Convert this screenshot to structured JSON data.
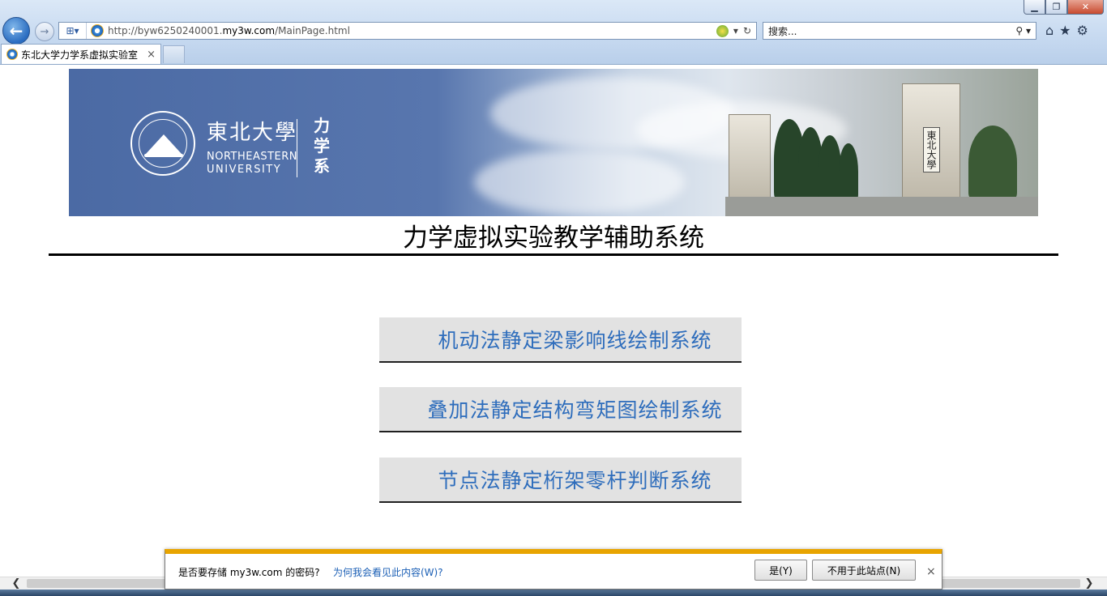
{
  "browser": {
    "address_url_prefix": "http://byw6250240001.",
    "address_url_host": "my3w.com",
    "address_url_path": "/MainPage.html",
    "search_placeholder": "搜索...",
    "tab_title": "东北大学力学系虚拟实验室",
    "tab_close": "×",
    "window_minimize": "▁",
    "window_restore": "❐",
    "window_close": "✕"
  },
  "banner": {
    "university_cn": "東北大學",
    "university_en_line1": "NORTHEASTERN",
    "university_en_line2": "UNIVERSITY",
    "department": "力学系",
    "gate_plaque": "東北大學"
  },
  "page": {
    "title": "力学虚拟实验教学辅助系统",
    "systems": [
      {
        "label": "机动法静定梁影响线绘制系统"
      },
      {
        "label": "叠加法静定结构弯矩图绘制系统"
      },
      {
        "label": "节点法静定桁架零杆判断系统"
      }
    ]
  },
  "notification": {
    "message": "是否要存储 my3w.com 的密码?",
    "help_link": "为何我会看见此内容(W)?",
    "yes_button": "是(Y)",
    "never_button": "不用于此站点(N)",
    "close": "×"
  },
  "colors": {
    "banner_blue": "#4b6aa4",
    "button_text": "#2e6dbc",
    "notify_accent": "#e8a400"
  }
}
